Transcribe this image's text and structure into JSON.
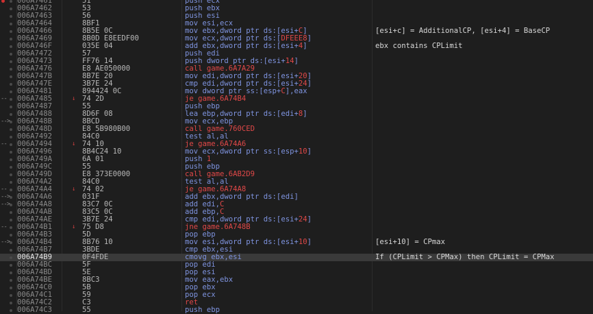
{
  "colors": {
    "background": "#1e1e1e",
    "instruction": "#7f94e0",
    "call_jump": "#e04848",
    "breakpoint": "#d03030",
    "selected_row": "#3a3a3a"
  },
  "rows": [
    {
      "addr": "006A7461",
      "bytes": "51",
      "pre": "push ecx",
      "hl": "",
      "post": "",
      "comment": "",
      "kind": "",
      "bp": true
    },
    {
      "addr": "006A7462",
      "bytes": "53",
      "pre": "push ebx",
      "hl": "",
      "post": "",
      "comment": "",
      "kind": ""
    },
    {
      "addr": "006A7463",
      "bytes": "56",
      "pre": "push esi",
      "hl": "",
      "post": "",
      "comment": "",
      "kind": ""
    },
    {
      "addr": "006A7464",
      "bytes": "8BF1",
      "pre": "mov esi,ecx",
      "hl": "",
      "post": "",
      "comment": "",
      "kind": ""
    },
    {
      "addr": "006A7466",
      "bytes": "8B5E 0C",
      "pre": "mov ebx,dword ptr ds:[esi+",
      "hl": "C",
      "post": "]",
      "comment": "[esi+c] = AdditionalCP, [esi+4] = BaseCP",
      "kind": ""
    },
    {
      "addr": "006A7469",
      "bytes": "8B0D E8EEDF00",
      "pre": "mov ecx,dword ptr ds:[",
      "hl": "DFEEE8",
      "post": "]",
      "comment": "",
      "kind": ""
    },
    {
      "addr": "006A746F",
      "bytes": "035E 04",
      "pre": "add ebx,dword ptr ds:[esi+",
      "hl": "4",
      "post": "]",
      "comment": "ebx contains CPLimit",
      "kind": ""
    },
    {
      "addr": "006A7472",
      "bytes": "57",
      "pre": "push edi",
      "hl": "",
      "post": "",
      "comment": "",
      "kind": ""
    },
    {
      "addr": "006A7473",
      "bytes": "FF76 14",
      "pre": "push dword ptr ds:[esi+",
      "hl": "14",
      "post": "]",
      "comment": "",
      "kind": ""
    },
    {
      "addr": "006A7476",
      "bytes": "E8 AE050000",
      "pre": "call game.6A7A29",
      "hl": "",
      "post": "",
      "comment": "",
      "kind": "call"
    },
    {
      "addr": "006A747B",
      "bytes": "8B7E 20",
      "pre": "mov edi,dword ptr ds:[esi+",
      "hl": "20",
      "post": "]",
      "comment": "",
      "kind": ""
    },
    {
      "addr": "006A747E",
      "bytes": "3B7E 24",
      "pre": "cmp edi,dword ptr ds:[esi+",
      "hl": "24",
      "post": "]",
      "comment": "",
      "kind": ""
    },
    {
      "addr": "006A7481",
      "bytes": "894424 0C",
      "pre": "mov dword ptr ss:[esp+",
      "hl": "C",
      "post": "],eax",
      "comment": "",
      "kind": ""
    },
    {
      "addr": "006A7485",
      "bytes": "74 2D",
      "pre": "je game.6A74B4",
      "hl": "",
      "post": "",
      "comment": "",
      "kind": "jmp",
      "jm": true,
      "arrow": "--"
    },
    {
      "addr": "006A7487",
      "bytes": "55",
      "pre": "push ebp",
      "hl": "",
      "post": "",
      "comment": "",
      "kind": ""
    },
    {
      "addr": "006A7488",
      "bytes": "8D6F 08",
      "pre": "lea ebp,dword ptr ds:[edi+",
      "hl": "8",
      "post": "]",
      "comment": "",
      "kind": ""
    },
    {
      "addr": "006A748B",
      "bytes": "8BCD",
      "pre": "mov ecx,ebp",
      "hl": "",
      "post": "",
      "comment": "",
      "kind": "",
      "arrow": "->"
    },
    {
      "addr": "006A748D",
      "bytes": "E8 5B980B00",
      "pre": "call game.760CED",
      "hl": "",
      "post": "",
      "comment": "",
      "kind": "call"
    },
    {
      "addr": "006A7492",
      "bytes": "84C0",
      "pre": "test al,al",
      "hl": "",
      "post": "",
      "comment": "",
      "kind": ""
    },
    {
      "addr": "006A7494",
      "bytes": "74 10",
      "pre": "je game.6A74A6",
      "hl": "",
      "post": "",
      "comment": "",
      "kind": "jmp",
      "jm": true,
      "arrow": "--"
    },
    {
      "addr": "006A7496",
      "bytes": "8B4C24 10",
      "pre": "mov ecx,dword ptr ss:[esp+",
      "hl": "10",
      "post": "]",
      "comment": "",
      "kind": ""
    },
    {
      "addr": "006A749A",
      "bytes": "6A 01",
      "pre": "push ",
      "hl": "1",
      "post": "",
      "comment": "",
      "kind": ""
    },
    {
      "addr": "006A749C",
      "bytes": "55",
      "pre": "push ebp",
      "hl": "",
      "post": "",
      "comment": "",
      "kind": ""
    },
    {
      "addr": "006A749D",
      "bytes": "E8 373E0000",
      "pre": "call game.6AB2D9",
      "hl": "",
      "post": "",
      "comment": "",
      "kind": "call"
    },
    {
      "addr": "006A74A2",
      "bytes": "84C0",
      "pre": "test al,al",
      "hl": "",
      "post": "",
      "comment": "",
      "kind": ""
    },
    {
      "addr": "006A74A4",
      "bytes": "74 02",
      "pre": "je game.6A74A8",
      "hl": "",
      "post": "",
      "comment": "",
      "kind": "jmp",
      "jm": true,
      "arrow": "--"
    },
    {
      "addr": "006A74A6",
      "bytes": "031F",
      "pre": "add ebx,dword ptr ds:[edi]",
      "hl": "",
      "post": "",
      "comment": "",
      "kind": "",
      "arrow": "->"
    },
    {
      "addr": "006A74A8",
      "bytes": "83C7 0C",
      "pre": "add edi,",
      "hl": "C",
      "post": "",
      "comment": "",
      "kind": "",
      "arrow": "->"
    },
    {
      "addr": "006A74AB",
      "bytes": "83C5 0C",
      "pre": "add ebp,",
      "hl": "C",
      "post": "",
      "comment": "",
      "kind": ""
    },
    {
      "addr": "006A74AE",
      "bytes": "3B7E 24",
      "pre": "cmp edi,dword ptr ds:[esi+",
      "hl": "24",
      "post": "]",
      "comment": "",
      "kind": ""
    },
    {
      "addr": "006A74B1",
      "bytes": "75 D8",
      "pre": "jne game.6A748B",
      "hl": "",
      "post": "",
      "comment": "",
      "kind": "jmp",
      "jm": true,
      "arrow": "--"
    },
    {
      "addr": "006A74B3",
      "bytes": "5D",
      "pre": "pop ebp",
      "hl": "",
      "post": "",
      "comment": "",
      "kind": ""
    },
    {
      "addr": "006A74B4",
      "bytes": "8B76 10",
      "pre": "mov esi,dword ptr ds:[esi+",
      "hl": "10",
      "post": "]",
      "comment": "[esi+10] = CPmax",
      "kind": "",
      "arrow": "->"
    },
    {
      "addr": "006A74B7",
      "bytes": "3BDE",
      "pre": "cmp ebx,esi",
      "hl": "",
      "post": "",
      "comment": "",
      "kind": ""
    },
    {
      "addr": "006A74B9",
      "bytes": "0F4FDE",
      "pre": "cmovg ebx,esi",
      "hl": "",
      "post": "",
      "comment": "If (CPLimit > CPMax) then CPLimit = CPMax",
      "kind": "",
      "selected": true
    },
    {
      "addr": "006A74BC",
      "bytes": "5F",
      "pre": "pop edi",
      "hl": "",
      "post": "",
      "comment": "",
      "kind": ""
    },
    {
      "addr": "006A74BD",
      "bytes": "5E",
      "pre": "pop esi",
      "hl": "",
      "post": "",
      "comment": "",
      "kind": ""
    },
    {
      "addr": "006A74BE",
      "bytes": "8BC3",
      "pre": "mov eax,ebx",
      "hl": "",
      "post": "",
      "comment": "",
      "kind": ""
    },
    {
      "addr": "006A74C0",
      "bytes": "5B",
      "pre": "pop ebx",
      "hl": "",
      "post": "",
      "comment": "",
      "kind": ""
    },
    {
      "addr": "006A74C1",
      "bytes": "59",
      "pre": "pop ecx",
      "hl": "",
      "post": "",
      "comment": "",
      "kind": ""
    },
    {
      "addr": "006A74C2",
      "bytes": "C3",
      "pre": "ret",
      "hl": "",
      "post": "",
      "comment": "",
      "kind": "ret"
    },
    {
      "addr": "006A74C3",
      "bytes": "55",
      "pre": "push ebp",
      "hl": "",
      "post": "",
      "comment": "",
      "kind": ""
    }
  ]
}
